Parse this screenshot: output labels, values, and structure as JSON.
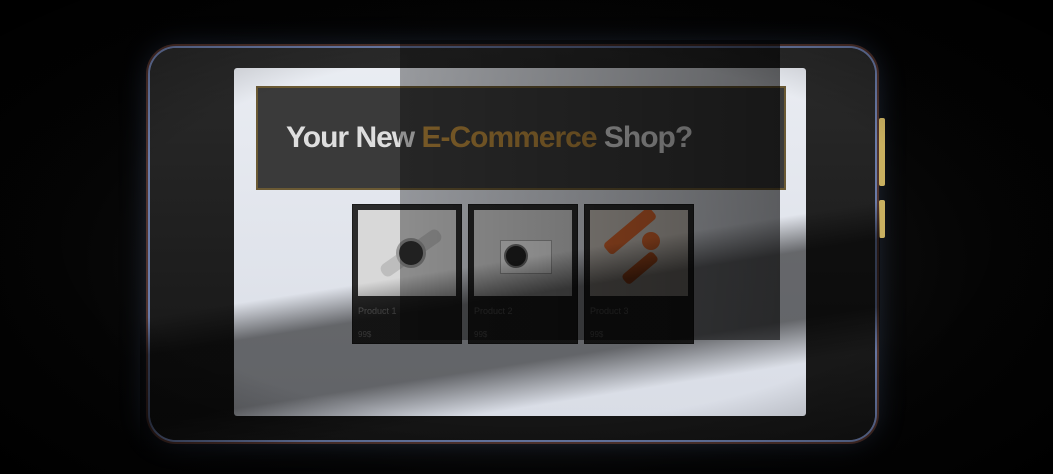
{
  "hero": {
    "title_part1": "Your New ",
    "title_accent": "E-Commerce",
    "title_part2": " Shop?"
  },
  "colors": {
    "accent": "#b98a3c",
    "hero_bg": "#3a3a3a",
    "card_bg": "#2b2b2b"
  },
  "products": [
    {
      "name": "Product 1",
      "price": "99$",
      "image": "smartwatch-image"
    },
    {
      "name": "Product 2",
      "price": "99$",
      "image": "camera-image"
    },
    {
      "name": "Product 3",
      "price": "99$",
      "image": "orange-abstract-image"
    }
  ]
}
